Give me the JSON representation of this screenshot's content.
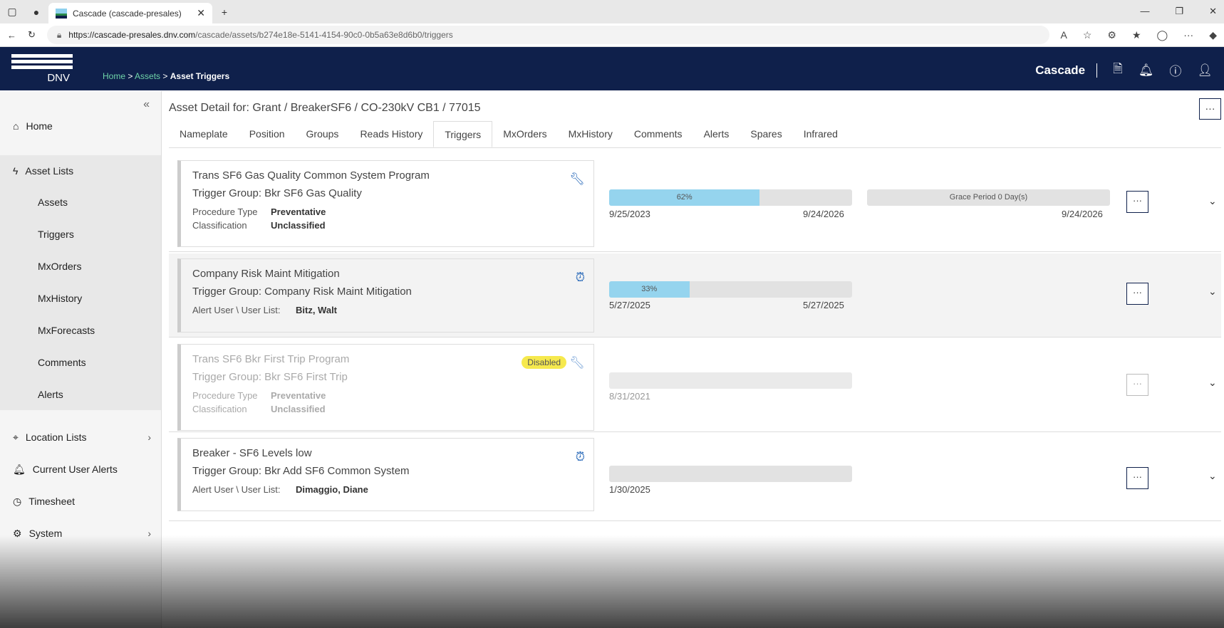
{
  "browser": {
    "tab_title": "Cascade (cascade-presales)",
    "url_host": "https://cascade-presales.dnv.com",
    "url_path": "/cascade/assets/b274e18e-5141-4154-90c0-0b5a63e8d6b0/triggers"
  },
  "header": {
    "logo": "DNV",
    "brand": "Cascade",
    "breadcrumb": [
      "Home",
      "Assets",
      "Asset Triggers"
    ],
    "sep": ">"
  },
  "sidebar": {
    "items": [
      {
        "label": "Home",
        "icon": "home-icon"
      },
      {
        "label": "Asset Lists",
        "icon": "bolt-icon"
      },
      {
        "label": "Assets"
      },
      {
        "label": "Triggers"
      },
      {
        "label": "MxOrders"
      },
      {
        "label": "MxHistory"
      },
      {
        "label": "MxForecasts"
      },
      {
        "label": "Comments"
      },
      {
        "label": "Alerts"
      },
      {
        "label": "Location Lists",
        "icon": "location-icon"
      },
      {
        "label": "Current User Alerts",
        "icon": "bell-icon"
      },
      {
        "label": "Timesheet",
        "icon": "clock-icon"
      },
      {
        "label": "System",
        "icon": "gear-icon"
      }
    ]
  },
  "page": {
    "title_prefix": "Asset Detail for:",
    "asset": "Grant / BreakerSF6 / CO-230kV CB1 / 77015",
    "tabs": [
      "Nameplate",
      "Position",
      "Groups",
      "Reads History",
      "Triggers",
      "MxOrders",
      "MxHistory",
      "Comments",
      "Alerts",
      "Spares",
      "Infrared"
    ],
    "active_tab": "Triggers"
  },
  "triggers": [
    {
      "name": "Trans SF6 Gas Quality Common System Program",
      "group": "Trigger Group: Bkr SF6 Gas Quality",
      "k1": "Procedure Type",
      "v1": "Preventative",
      "k2": "Classification",
      "v2": "Unclassified",
      "icon": "wrench-icon",
      "progress": 62,
      "progress_label": "62%",
      "start": "9/25/2023",
      "end": "9/24/2026",
      "grace_label": "Grace Period 0 Day(s)",
      "grace_date": "9/24/2026"
    },
    {
      "name": "Company Risk Maint Mitigation",
      "group": "Trigger Group: Company Risk Maint Mitigation",
      "k1": "Alert User \\ User List:",
      "v1": "Bitz, Walt",
      "icon": "alarm-clock-icon",
      "progress": 33,
      "progress_label": "33%",
      "start": "5/27/2025",
      "end": "5/27/2025"
    },
    {
      "name": "Trans SF6 Bkr First Trip Program",
      "group": "Trigger Group: Bkr SF6 First Trip",
      "k1": "Procedure Type",
      "v1": "Preventative",
      "k2": "Classification",
      "v2": "Unclassified",
      "icon": "wrench-icon",
      "badge": "Disabled",
      "progress": 0,
      "start": "8/31/2021"
    },
    {
      "name": "Breaker - SF6 Levels low",
      "group": "Trigger Group: Bkr Add SF6 Common System",
      "k1": "Alert User \\ User List:",
      "v1": "Dimaggio, Diane",
      "icon": "alarm-clock-icon",
      "progress": 0,
      "start": "1/30/2025"
    }
  ],
  "more_label": "···"
}
